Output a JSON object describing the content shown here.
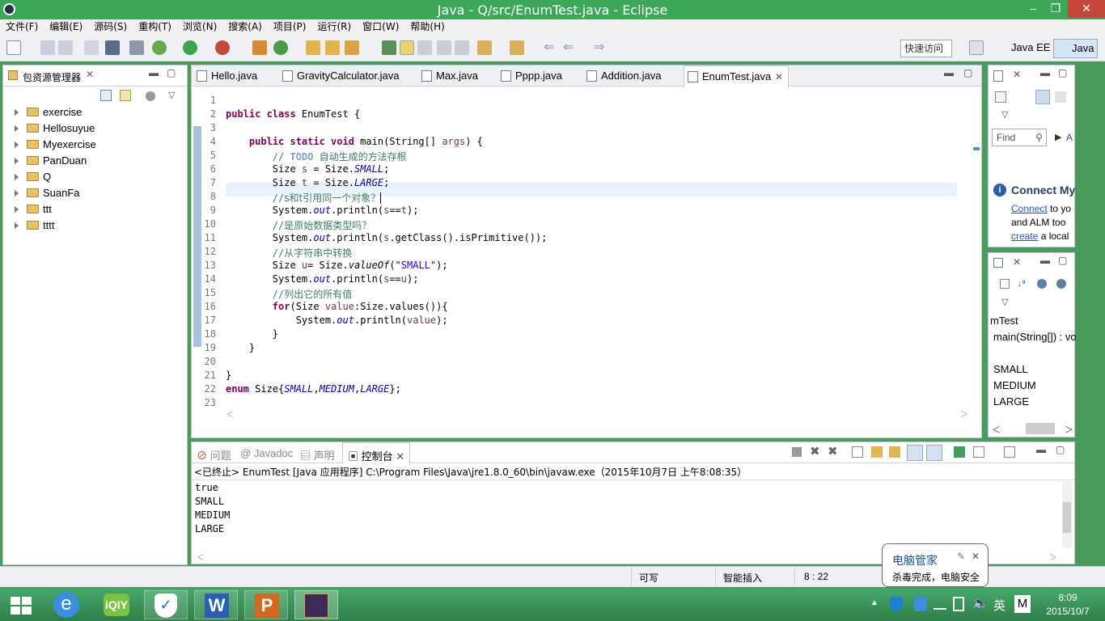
{
  "window": {
    "title": "Java - Q/src/EnumTest.java - Eclipse",
    "minimize": "–",
    "restore": "❐",
    "close": "✕"
  },
  "menu": [
    "文件(F)",
    "编辑(E)",
    "源码(S)",
    "重构(T)",
    "浏览(N)",
    "搜索(A)",
    "项目(P)",
    "运行(R)",
    "窗口(W)",
    "帮助(H)"
  ],
  "toolbar": {
    "quick_access": "快速访问",
    "perspective_javaee": "Java EE",
    "perspective_java": "Java"
  },
  "package_explorer": {
    "title": "包资源管理器",
    "projects": [
      "exercise",
      "Hellosuyue",
      "Myexercise",
      "PanDuan",
      "Q",
      "SuanFa",
      "ttt",
      "tttt"
    ]
  },
  "editor": {
    "tabs": [
      "Hello.java",
      "GravityCalculator.java",
      "Max.java",
      "Pppp.java",
      "Addition.java",
      "EnumTest.java"
    ],
    "active_tab": "EnumTest.java",
    "line_numbers": [
      "1",
      "2",
      "3",
      "4",
      "5",
      "6",
      "7",
      "8",
      "9",
      "10",
      "11",
      "12",
      "13",
      "14",
      "15",
      "16",
      "17",
      "18",
      "19",
      "20",
      "21",
      "22",
      "23"
    ]
  },
  "outline_top": {
    "find_placeholder": "Find",
    "a_label": "A",
    "connect_title": "Connect My",
    "connect_link": "Connect",
    "connect_text1": " to yo",
    "connect_text2": "and ALM too",
    "create_link": "create",
    "connect_text3": " a local"
  },
  "outline": {
    "class_name": "mTest",
    "method": "main(String[]) : vo",
    "items": [
      "SMALL",
      "MEDIUM",
      "LARGE"
    ]
  },
  "console": {
    "tabs": [
      "问题",
      "Javadoc",
      "声明",
      "控制台"
    ],
    "active_tab": "控制台",
    "header": "<已终止> EnumTest [Java 应用程序] C:\\Program Files\\Java\\jre1.8.0_60\\bin\\javaw.exe（2015年10月7日 上午8:08:35）",
    "output": [
      "true",
      "SMALL",
      "MEDIUM",
      "LARGE"
    ]
  },
  "status": {
    "writable": "可写",
    "insert_mode": "智能插入",
    "position": "8 : 22"
  },
  "popup": {
    "title": "电脑管家",
    "message": "杀毒完成，电脑安全"
  },
  "taskbar": {
    "time": "8:09",
    "date": "2015/10/7",
    "ime": "英",
    "ime2": "M"
  }
}
